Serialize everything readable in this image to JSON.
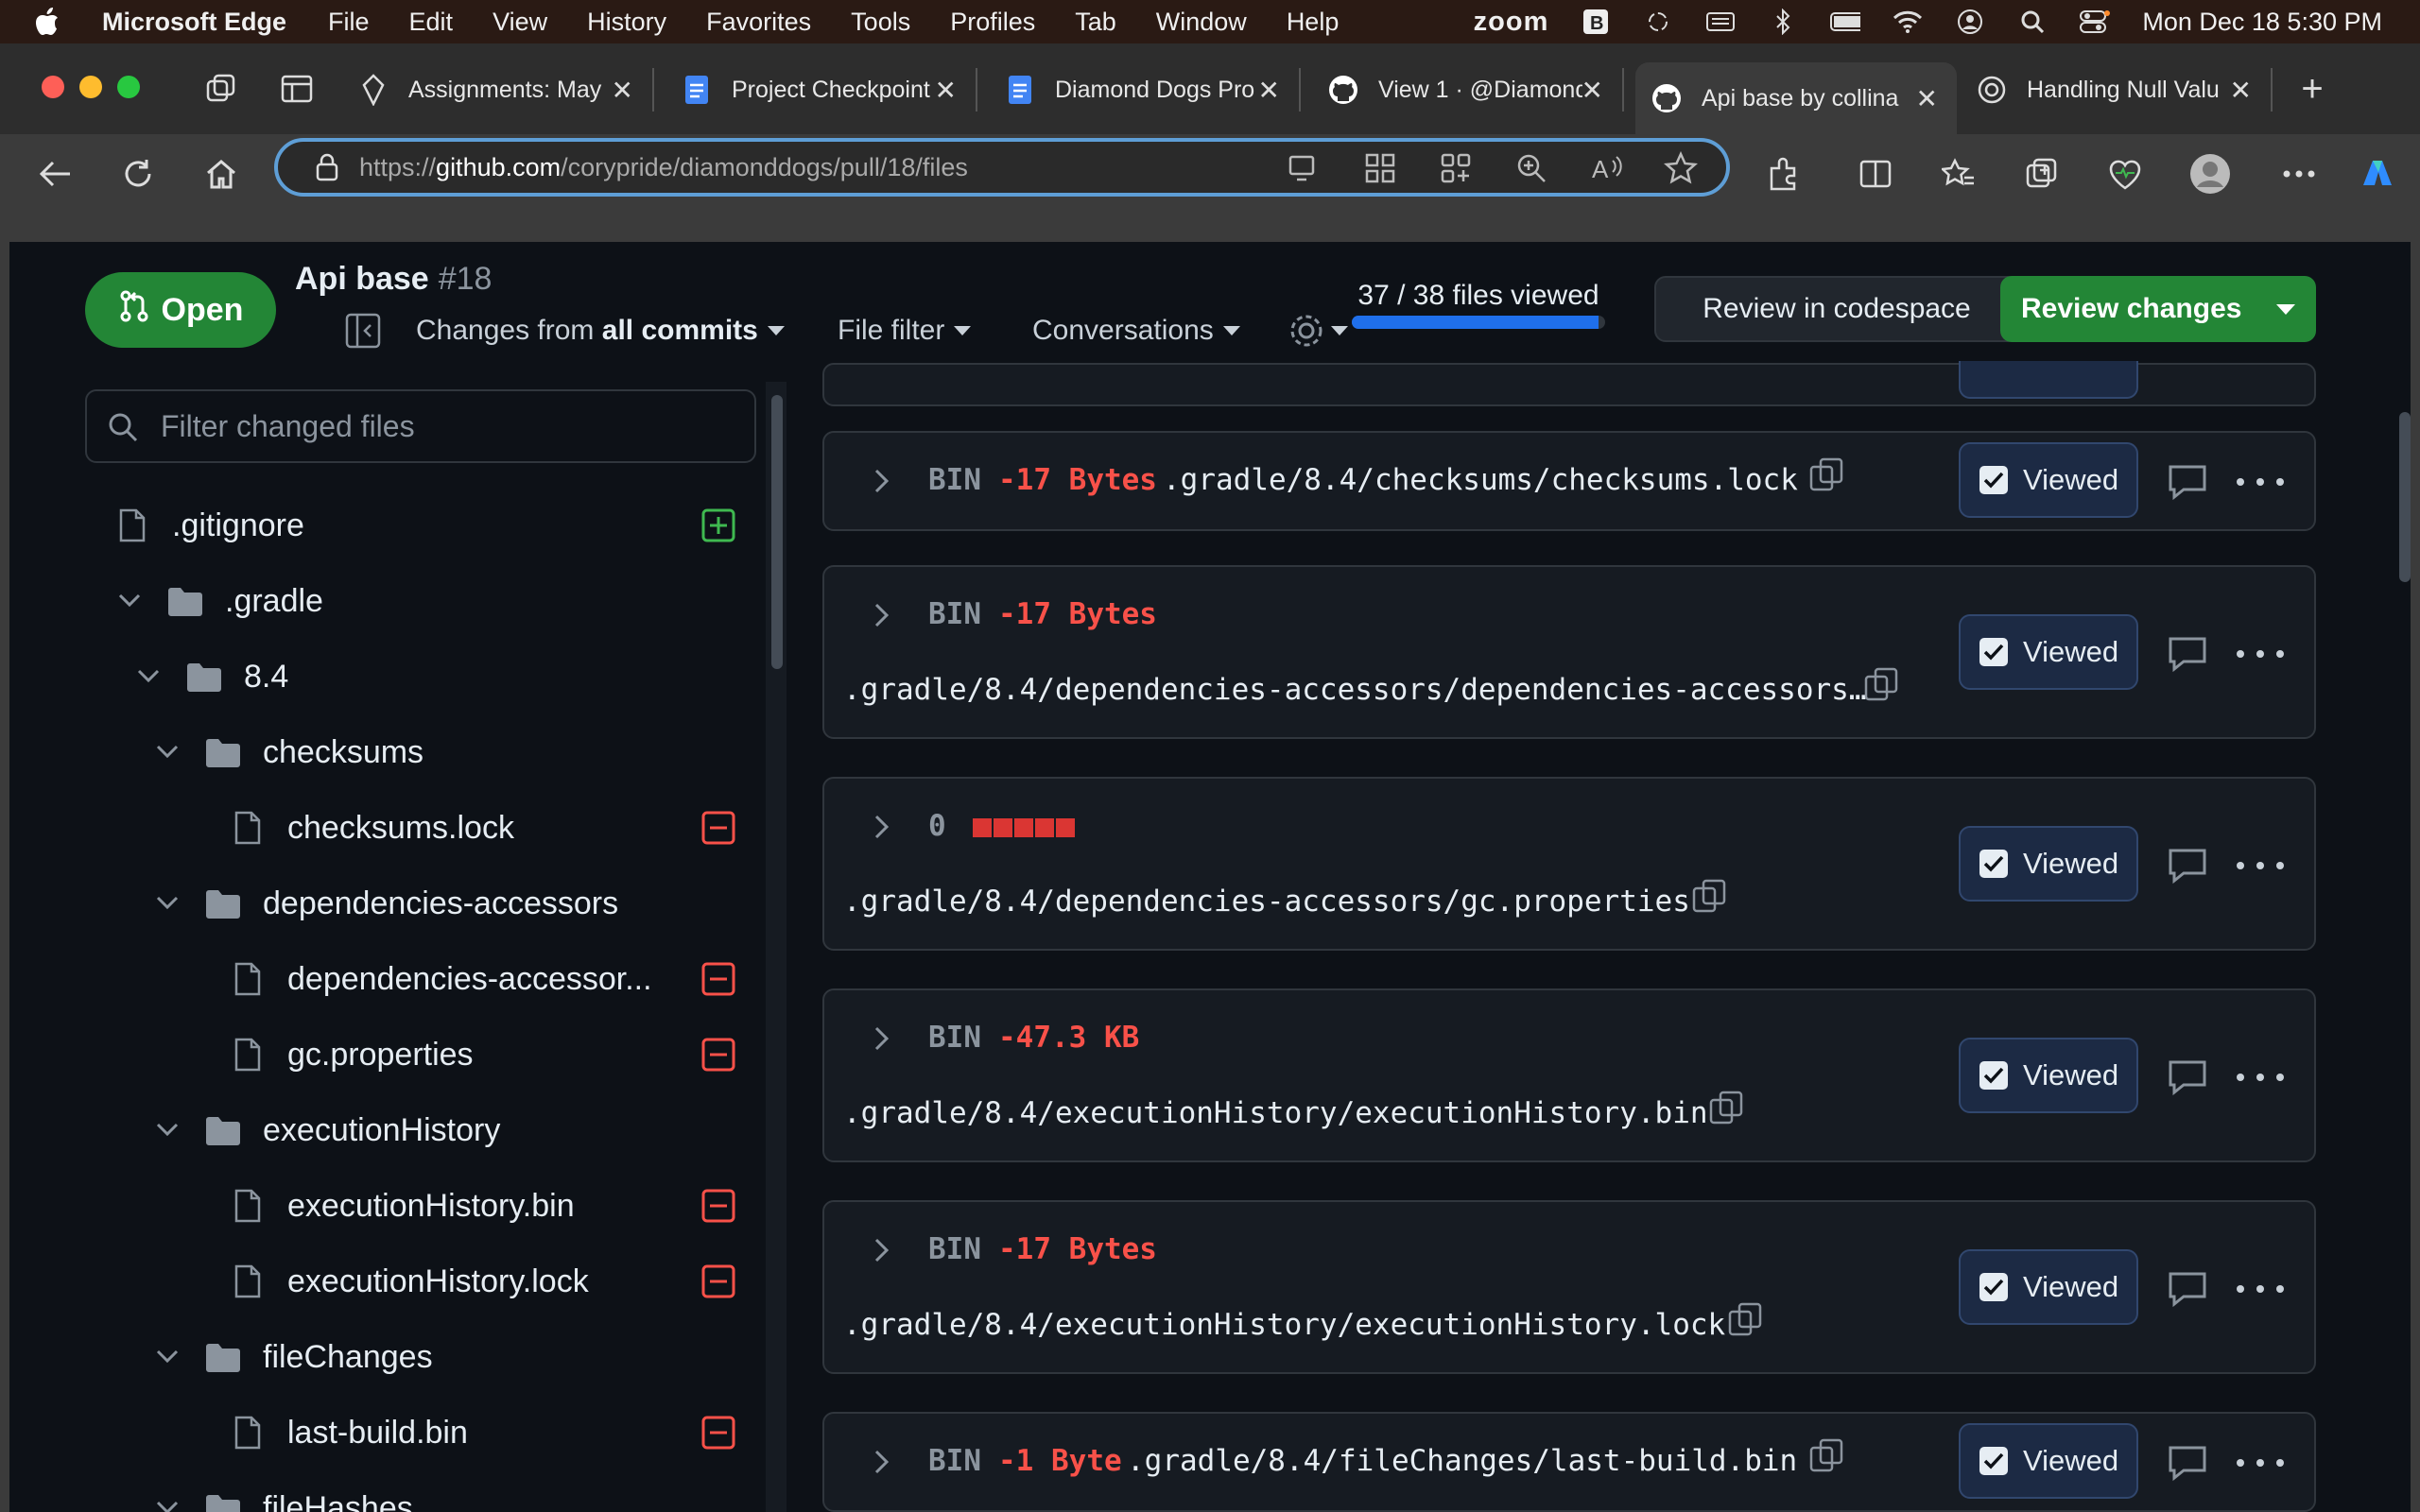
{
  "menubar": {
    "app": "Microsoft Edge",
    "items": [
      "File",
      "Edit",
      "View",
      "History",
      "Favorites",
      "Tools",
      "Profiles",
      "Tab",
      "Window",
      "Help"
    ],
    "zoom_label": "zoom",
    "clock": "Mon Dec 18  5:30 PM"
  },
  "tabs": [
    {
      "label": "Assignments: May",
      "icon": "canvas-icon"
    },
    {
      "label": "Project Checkpoint",
      "icon": "docs-icon"
    },
    {
      "label": "Diamond Dogs Pro",
      "icon": "docs-icon"
    },
    {
      "label": "View 1 · @Diamond",
      "icon": "github-icon"
    },
    {
      "label": "Api base by collina",
      "icon": "github-icon",
      "active": true
    },
    {
      "label": "Handling Null Valu",
      "icon": "chatgpt-icon"
    }
  ],
  "address": {
    "scheme": "https://",
    "host": "github.com",
    "path": "/corypride/diamonddogs/pull/18/files"
  },
  "pr": {
    "state": "Open",
    "title": "Api base",
    "number": "#18",
    "changes_from_prefix": "Changes from",
    "changes_from_value": "all commits",
    "file_filter": "File filter",
    "conversations": "Conversations",
    "viewed_progress": "37 / 38 files viewed",
    "viewed_fraction": 0.974,
    "review_codespace": "Review in codespace",
    "review_changes": "Review changes"
  },
  "sidebar": {
    "filter_placeholder": "Filter changed files",
    "tree": [
      {
        "type": "file",
        "name": ".gitignore",
        "status": "added"
      },
      {
        "type": "folder",
        "name": ".gradle"
      },
      {
        "type": "folder",
        "name": "8.4"
      },
      {
        "type": "folder",
        "name": "checksums"
      },
      {
        "type": "file",
        "name": "checksums.lock",
        "status": "removed"
      },
      {
        "type": "folder",
        "name": "dependencies-accessors"
      },
      {
        "type": "file",
        "name": "dependencies-accessor...",
        "status": "removed"
      },
      {
        "type": "file",
        "name": "gc.properties",
        "status": "removed"
      },
      {
        "type": "folder",
        "name": "executionHistory"
      },
      {
        "type": "file",
        "name": "executionHistory.bin",
        "status": "removed"
      },
      {
        "type": "file",
        "name": "executionHistory.lock",
        "status": "removed"
      },
      {
        "type": "folder",
        "name": "fileChanges"
      },
      {
        "type": "file",
        "name": "last-build.bin",
        "status": "removed"
      },
      {
        "type": "folder",
        "name": "fileHashes"
      }
    ]
  },
  "diffs": [
    {
      "kind": "BIN",
      "change": "-17 Bytes",
      "path": ".gradle/8.4/checksums/checksums.lock",
      "viewed": "Viewed"
    },
    {
      "kind": "BIN",
      "change": "-17 Bytes",
      "path": ".gradle/8.4/dependencies-accessors/dependencies-accessors…",
      "viewed": "Viewed"
    },
    {
      "kind": "0",
      "change": "",
      "path": ".gradle/8.4/dependencies-accessors/gc.properties",
      "viewed": "Viewed"
    },
    {
      "kind": "BIN",
      "change": "-47.3 KB",
      "path": ".gradle/8.4/executionHistory/executionHistory.bin",
      "viewed": "Viewed"
    },
    {
      "kind": "BIN",
      "change": "-17 Bytes",
      "path": ".gradle/8.4/executionHistory/executionHistory.lock",
      "viewed": "Viewed"
    },
    {
      "kind": "BIN",
      "change": "-1 Byte",
      "path": ".gradle/8.4/fileChanges/last-build.bin",
      "viewed": "Viewed"
    }
  ],
  "colors": {
    "accent_green": "#238636",
    "removed_red": "#f85149",
    "added_green": "#3fb950",
    "progress_blue": "#1f6feb"
  }
}
